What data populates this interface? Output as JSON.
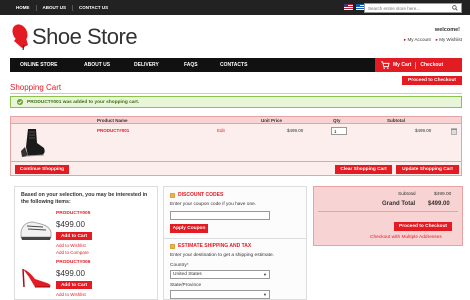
{
  "topbar": {
    "links": [
      "HOME",
      "ABOUT US",
      "CONTACT US"
    ],
    "search_placeholder": "Search entire store here..."
  },
  "header": {
    "logo_text": "Shoe Store",
    "welcome": "welcome!",
    "my_account": "My Account",
    "my_wishlist": "My Wishlist"
  },
  "nav": {
    "items": [
      "ONLINE STORE",
      "ABOUT US",
      "DELIVERY",
      "FAQS",
      "CONTACTS"
    ],
    "my_cart": "My Cart",
    "checkout": "Checkout"
  },
  "colors": {
    "accent": "#e31b23",
    "dark": "#111111",
    "pink": "#f8d3d3",
    "success_bg": "#e9f5d8"
  },
  "cart": {
    "proceed_top": "Proceed to Checkout",
    "title": "Shopping Cart",
    "success_msg": "PRODUCT#001 was added to your shopping cart.",
    "columns": [
      "Product Name",
      "Unit Price",
      "Qty",
      "Subtotal"
    ],
    "item": {
      "name": "PRODUCT#001",
      "edit": "Edit",
      "unit_price": "$499.00",
      "qty": "1",
      "subtotal": "$499.00"
    },
    "continue": "Continue Shopping",
    "clear": "Clear Shopping Cart",
    "update": "Update Shopping Cart"
  },
  "crosssell": {
    "title": "Based on your selection, you may be interested in the following items:",
    "items": [
      {
        "name": "PRODUCT#005",
        "price": "$499.00",
        "add": "Add to Cart",
        "wishlist": "Add to Wishlist",
        "compare": "Add to Compare"
      },
      {
        "name": "PRODUCT#006",
        "price": "$499.00",
        "add": "Add to Cart",
        "wishlist": "Add to Wishlist"
      }
    ]
  },
  "coupon": {
    "title": "DISCOUNT CODES",
    "prompt": "Enter your coupon code if you have one.",
    "apply": "Apply Coupon"
  },
  "shipping": {
    "title": "ESTIMATE SHIPPING AND TAX",
    "prompt": "Enter your destination to get a shipping estimate.",
    "country_label": "Country",
    "required_mark": "*",
    "country_value": "United States",
    "state_label": "State/Province"
  },
  "totals": {
    "subtotal_label": "Subtotal",
    "subtotal_value": "$499.00",
    "grand_label": "Grand Total",
    "grand_value": "$499.00",
    "proceed": "Proceed to Checkout",
    "multi": "Checkout with Multiple Addresses"
  }
}
